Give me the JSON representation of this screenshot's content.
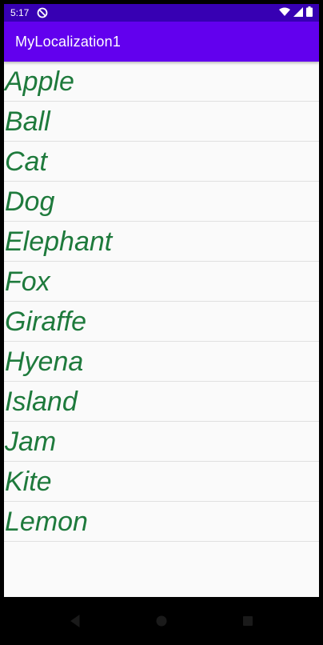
{
  "status_bar": {
    "time": "5:17",
    "icons": [
      "do-not-disturb-icon",
      "wifi-icon",
      "signal-icon",
      "battery-icon"
    ],
    "background": "#3700b3"
  },
  "app_bar": {
    "title": "MyLocalization1",
    "background": "#6200ee"
  },
  "list": {
    "text_color": "#1e7a3c",
    "items": [
      "Apple",
      "Ball",
      "Cat",
      "Dog",
      "Elephant",
      "Fox",
      "Giraffe",
      "Hyena",
      "Island",
      "Jam",
      "Kite",
      "Lemon"
    ]
  },
  "nav_bar": {
    "buttons": [
      "back-icon",
      "home-icon",
      "recents-icon"
    ]
  }
}
